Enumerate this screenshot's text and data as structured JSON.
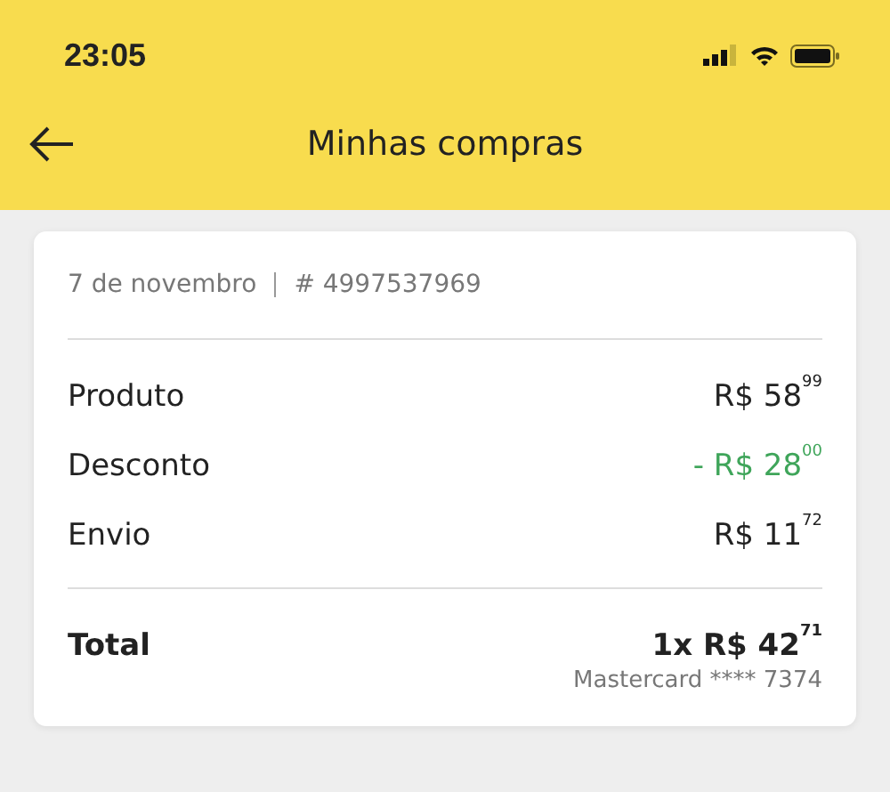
{
  "status_bar": {
    "time": "23:05"
  },
  "header": {
    "title": "Minhas compras"
  },
  "order": {
    "date": "7 de novembro",
    "number": "# 4997537969",
    "lines": [
      {
        "label": "Produto",
        "amount": "R$ 58$^{99}$",
        "kind": "normal"
      },
      {
        "label": "Desconto",
        "amount": "- R$ 28$^{00}$",
        "kind": "discount"
      },
      {
        "label": "Envio",
        "amount": "R$ 11$^{72}$",
        "kind": "normal"
      }
    ],
    "total": {
      "label": "Total",
      "amount": "1x R$ 42$^{71}$",
      "payment": "Mastercard **** 7374"
    }
  }
}
